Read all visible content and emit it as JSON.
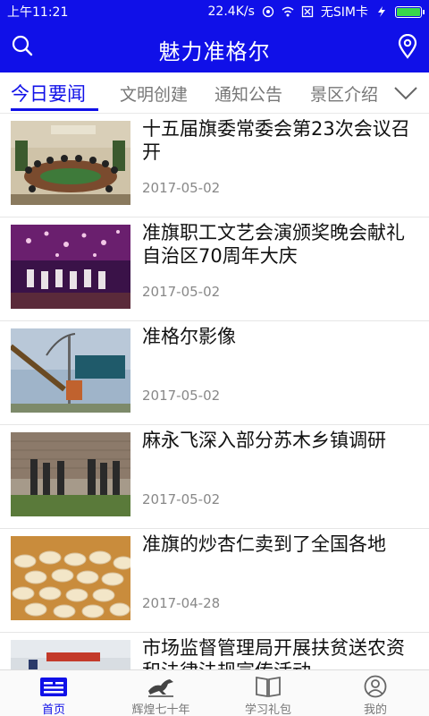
{
  "status": {
    "time": "上午11:21",
    "speed": "22.4K/s",
    "sim": "无SIM卡",
    "battery_level": 1.0
  },
  "header": {
    "title": "魅力准格尔",
    "icons": [
      "search-icon",
      "location-pin-icon"
    ]
  },
  "tabs": [
    {
      "label": "今日要闻",
      "active": true
    },
    {
      "label": "文明创建",
      "active": false
    },
    {
      "label": "通知公告",
      "active": false
    },
    {
      "label": "景区介绍",
      "active": false
    }
  ],
  "news": [
    {
      "title": "十五届旗委常委会第23次会议召开",
      "date": "2017-05-02"
    },
    {
      "title": "准旗职工文艺会演颁奖晚会献礼自治区70周年大庆",
      "date": "2017-05-02"
    },
    {
      "title": "准格尔影像",
      "date": "2017-05-02"
    },
    {
      "title": "麻永飞深入部分苏木乡镇调研",
      "date": "2017-05-02"
    },
    {
      "title": "准旗的炒杏仁卖到了全国各地",
      "date": "2017-04-28"
    },
    {
      "title": "市场监督管理局开展扶贫送农资和法律法规宣传活动",
      "date": ""
    }
  ],
  "bottom_nav": [
    {
      "label": "首页",
      "icon": "newspaper-icon",
      "active": true
    },
    {
      "label": "辉煌七十年",
      "icon": "horse-icon",
      "active": false
    },
    {
      "label": "学习礼包",
      "icon": "book-icon",
      "active": false
    },
    {
      "label": "我的",
      "icon": "user-icon",
      "active": false
    }
  ],
  "colors": {
    "brand": "#1010e8",
    "text": "#111111",
    "muted": "#888888"
  }
}
